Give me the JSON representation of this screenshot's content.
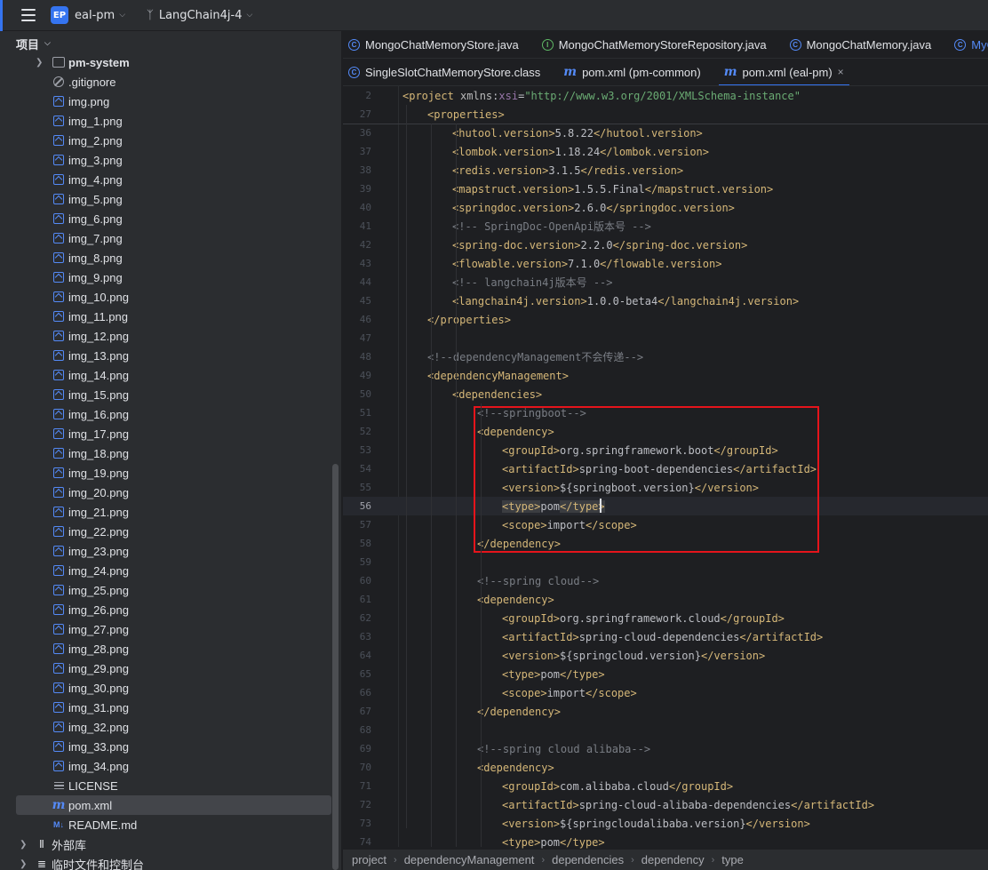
{
  "titlebar": {
    "project_badge": "EP",
    "project_name": "eal-pm",
    "branch_name": "LangChain4j-4"
  },
  "project_panel": {
    "title": "项目",
    "items": [
      {
        "label": "pm-system",
        "icon": "folder-icon",
        "bold": true,
        "expandable": true
      },
      {
        "label": ".gitignore",
        "icon": "ignore-icon"
      },
      {
        "label": "img.png",
        "icon": "image-icon"
      },
      {
        "label": "img_1.png",
        "icon": "image-icon"
      },
      {
        "label": "img_2.png",
        "icon": "image-icon"
      },
      {
        "label": "img_3.png",
        "icon": "image-icon"
      },
      {
        "label": "img_4.png",
        "icon": "image-icon"
      },
      {
        "label": "img_5.png",
        "icon": "image-icon"
      },
      {
        "label": "img_6.png",
        "icon": "image-icon"
      },
      {
        "label": "img_7.png",
        "icon": "image-icon"
      },
      {
        "label": "img_8.png",
        "icon": "image-icon"
      },
      {
        "label": "img_9.png",
        "icon": "image-icon"
      },
      {
        "label": "img_10.png",
        "icon": "image-icon"
      },
      {
        "label": "img_11.png",
        "icon": "image-icon"
      },
      {
        "label": "img_12.png",
        "icon": "image-icon"
      },
      {
        "label": "img_13.png",
        "icon": "image-icon"
      },
      {
        "label": "img_14.png",
        "icon": "image-icon"
      },
      {
        "label": "img_15.png",
        "icon": "image-icon"
      },
      {
        "label": "img_16.png",
        "icon": "image-icon"
      },
      {
        "label": "img_17.png",
        "icon": "image-icon"
      },
      {
        "label": "img_18.png",
        "icon": "image-icon"
      },
      {
        "label": "img_19.png",
        "icon": "image-icon"
      },
      {
        "label": "img_20.png",
        "icon": "image-icon"
      },
      {
        "label": "img_21.png",
        "icon": "image-icon"
      },
      {
        "label": "img_22.png",
        "icon": "image-icon"
      },
      {
        "label": "img_23.png",
        "icon": "image-icon"
      },
      {
        "label": "img_24.png",
        "icon": "image-icon"
      },
      {
        "label": "img_25.png",
        "icon": "image-icon"
      },
      {
        "label": "img_26.png",
        "icon": "image-icon"
      },
      {
        "label": "img_27.png",
        "icon": "image-icon"
      },
      {
        "label": "img_28.png",
        "icon": "image-icon"
      },
      {
        "label": "img_29.png",
        "icon": "image-icon"
      },
      {
        "label": "img_30.png",
        "icon": "image-icon"
      },
      {
        "label": "img_31.png",
        "icon": "image-icon"
      },
      {
        "label": "img_32.png",
        "icon": "image-icon"
      },
      {
        "label": "img_33.png",
        "icon": "image-icon"
      },
      {
        "label": "img_34.png",
        "icon": "image-icon"
      },
      {
        "label": "LICENSE",
        "icon": "text-file-icon"
      },
      {
        "label": "pom.xml",
        "icon": "maven-icon",
        "selected": true
      },
      {
        "label": "README.md",
        "icon": "markdown-icon"
      },
      {
        "label": "外部库",
        "icon": "library-icon",
        "expandable": true,
        "root": true
      },
      {
        "label": "临时文件和控制台",
        "icon": "scratches-icon",
        "expandable": true,
        "root": true
      }
    ]
  },
  "editor": {
    "tabs_row1": [
      {
        "label": "MongoChatMemoryStore.java",
        "icon": "class-icon"
      },
      {
        "label": "MongoChatMemoryStoreRepository.java",
        "icon": "interface-icon"
      },
      {
        "label": "MongoChatMemory.java",
        "icon": "class-icon"
      },
      {
        "label": "MyChatAssi",
        "icon": "class-icon",
        "link": true
      }
    ],
    "tabs_row2": [
      {
        "label": "SingleSlotChatMemoryStore.class",
        "icon": "class-icon"
      },
      {
        "label": "pom.xml (pm-common)",
        "icon": "maven-icon"
      },
      {
        "label": "pom.xml (eal-pm)",
        "icon": "maven-icon",
        "active": true,
        "close": "×"
      }
    ],
    "current_line": 56,
    "lines": [
      {
        "n": 2,
        "indent": 0,
        "parts": [
          [
            "tag",
            "<project "
          ],
          [
            "attr",
            "xmlns"
          ],
          [
            "txt",
            ":"
          ],
          [
            "ns",
            "xsi"
          ],
          [
            "txt",
            "="
          ],
          [
            "str",
            "\"http://www.w3.org/2001/XMLSchema-instance\""
          ],
          [
            "tag",
            ""
          ]
        ]
      },
      {
        "n": 27,
        "indent": 1,
        "parts": [
          [
            "tag",
            "<properties>"
          ]
        ]
      },
      {
        "n": 36,
        "indent": 2,
        "parts": [
          [
            "tag",
            "<hutool.version>"
          ],
          [
            "txt",
            "5.8.22"
          ],
          [
            "tag",
            "</hutool.version>"
          ]
        ]
      },
      {
        "n": 37,
        "indent": 2,
        "parts": [
          [
            "tag",
            "<lombok.version>"
          ],
          [
            "txt",
            "1.18.24"
          ],
          [
            "tag",
            "</lombok.version>"
          ]
        ]
      },
      {
        "n": 38,
        "indent": 2,
        "parts": [
          [
            "tag",
            "<redis.version>"
          ],
          [
            "txt",
            "3.1.5"
          ],
          [
            "tag",
            "</redis.version>"
          ]
        ]
      },
      {
        "n": 39,
        "indent": 2,
        "parts": [
          [
            "tag",
            "<mapstruct.version>"
          ],
          [
            "txt",
            "1.5.5.Final"
          ],
          [
            "tag",
            "</mapstruct.version>"
          ]
        ]
      },
      {
        "n": 40,
        "indent": 2,
        "parts": [
          [
            "tag",
            "<springdoc.version>"
          ],
          [
            "txt",
            "2.6.0"
          ],
          [
            "tag",
            "</springdoc.version>"
          ]
        ]
      },
      {
        "n": 41,
        "indent": 2,
        "parts": [
          [
            "cmt",
            "<!-- SpringDoc-OpenApi版本号 -->"
          ]
        ]
      },
      {
        "n": 42,
        "indent": 2,
        "parts": [
          [
            "tag",
            "<spring-doc.version>"
          ],
          [
            "txt",
            "2.2.0"
          ],
          [
            "tag",
            "</spring-doc.version>"
          ]
        ]
      },
      {
        "n": 43,
        "indent": 2,
        "parts": [
          [
            "tag",
            "<flowable.version>"
          ],
          [
            "txt",
            "7.1.0"
          ],
          [
            "tag",
            "</flowable.version>"
          ]
        ]
      },
      {
        "n": 44,
        "indent": 2,
        "parts": [
          [
            "cmt",
            "<!-- langchain4j版本号 -->"
          ]
        ]
      },
      {
        "n": 45,
        "indent": 2,
        "parts": [
          [
            "tag",
            "<langchain4j.version>"
          ],
          [
            "txt",
            "1.0.0-beta4"
          ],
          [
            "tag",
            "</langchain4j.version>"
          ]
        ]
      },
      {
        "n": 46,
        "indent": 1,
        "parts": [
          [
            "tag",
            "</properties>"
          ]
        ]
      },
      {
        "n": 47,
        "indent": 0,
        "parts": []
      },
      {
        "n": 48,
        "indent": 1,
        "parts": [
          [
            "cmt",
            "<!--dependencyManagement不会传递-->"
          ]
        ]
      },
      {
        "n": 49,
        "indent": 1,
        "parts": [
          [
            "tag",
            "<dependencyManagement>"
          ]
        ]
      },
      {
        "n": 50,
        "indent": 2,
        "parts": [
          [
            "tag",
            "<dependencies>"
          ]
        ]
      },
      {
        "n": 51,
        "indent": 3,
        "parts": [
          [
            "cmt",
            "<!--springboot-->"
          ]
        ]
      },
      {
        "n": 52,
        "indent": 3,
        "parts": [
          [
            "tag",
            "<dependency>"
          ]
        ]
      },
      {
        "n": 53,
        "indent": 4,
        "parts": [
          [
            "tag",
            "<groupId>"
          ],
          [
            "txt",
            "org.springframework.boot"
          ],
          [
            "tag",
            "</groupId>"
          ]
        ]
      },
      {
        "n": 54,
        "indent": 4,
        "parts": [
          [
            "tag",
            "<artifactId>"
          ],
          [
            "txt",
            "spring-boot-dependencies"
          ],
          [
            "tag",
            "</artifactId>"
          ]
        ]
      },
      {
        "n": 55,
        "indent": 4,
        "parts": [
          [
            "tag",
            "<version>"
          ],
          [
            "txt",
            "${springboot.version}"
          ],
          [
            "tag",
            "</version>"
          ]
        ]
      },
      {
        "n": 56,
        "indent": 4,
        "parts": [
          [
            "tag hl",
            "<type>"
          ],
          [
            "txt",
            "pom"
          ],
          [
            "tag hl",
            "</type>"
          ]
        ]
      },
      {
        "n": 57,
        "indent": 4,
        "parts": [
          [
            "tag",
            "<scope>"
          ],
          [
            "txt",
            "import"
          ],
          [
            "tag",
            "</scope>"
          ]
        ]
      },
      {
        "n": 58,
        "indent": 3,
        "parts": [
          [
            "tag",
            "</dependency>"
          ]
        ]
      },
      {
        "n": 59,
        "indent": 0,
        "parts": []
      },
      {
        "n": 60,
        "indent": 3,
        "parts": [
          [
            "cmt",
            "<!--spring cloud-->"
          ]
        ]
      },
      {
        "n": 61,
        "indent": 3,
        "parts": [
          [
            "tag",
            "<dependency>"
          ]
        ]
      },
      {
        "n": 62,
        "indent": 4,
        "parts": [
          [
            "tag",
            "<groupId>"
          ],
          [
            "txt",
            "org.springframework.cloud"
          ],
          [
            "tag",
            "</groupId>"
          ]
        ]
      },
      {
        "n": 63,
        "indent": 4,
        "parts": [
          [
            "tag",
            "<artifactId>"
          ],
          [
            "txt",
            "spring-cloud-dependencies"
          ],
          [
            "tag",
            "</artifactId>"
          ]
        ]
      },
      {
        "n": 64,
        "indent": 4,
        "parts": [
          [
            "tag",
            "<version>"
          ],
          [
            "txt",
            "${springcloud.version}"
          ],
          [
            "tag",
            "</version>"
          ]
        ]
      },
      {
        "n": 65,
        "indent": 4,
        "parts": [
          [
            "tag",
            "<type>"
          ],
          [
            "txt",
            "pom"
          ],
          [
            "tag",
            "</type>"
          ]
        ]
      },
      {
        "n": 66,
        "indent": 4,
        "parts": [
          [
            "tag",
            "<scope>"
          ],
          [
            "txt",
            "import"
          ],
          [
            "tag",
            "</scope>"
          ]
        ]
      },
      {
        "n": 67,
        "indent": 3,
        "parts": [
          [
            "tag",
            "</dependency>"
          ]
        ]
      },
      {
        "n": 68,
        "indent": 0,
        "parts": []
      },
      {
        "n": 69,
        "indent": 3,
        "parts": [
          [
            "cmt",
            "<!--spring cloud alibaba-->"
          ]
        ]
      },
      {
        "n": 70,
        "indent": 3,
        "parts": [
          [
            "tag",
            "<dependency>"
          ]
        ]
      },
      {
        "n": 71,
        "indent": 4,
        "parts": [
          [
            "tag",
            "<groupId>"
          ],
          [
            "txt",
            "com.alibaba.cloud"
          ],
          [
            "tag",
            "</groupId>"
          ]
        ]
      },
      {
        "n": 72,
        "indent": 4,
        "parts": [
          [
            "tag",
            "<artifactId>"
          ],
          [
            "txt",
            "spring-cloud-alibaba-dependencies"
          ],
          [
            "tag",
            "</artifactId>"
          ]
        ]
      },
      {
        "n": 73,
        "indent": 4,
        "parts": [
          [
            "tag",
            "<version>"
          ],
          [
            "txt",
            "${springcloudalibaba.version}"
          ],
          [
            "tag",
            "</version>"
          ]
        ]
      },
      {
        "n": 74,
        "indent": 4,
        "parts": [
          [
            "tag",
            "<type>"
          ],
          [
            "txt",
            "pom"
          ],
          [
            "tag",
            "</type>"
          ]
        ]
      }
    ]
  },
  "breadcrumbs": [
    "project",
    "dependencyManagement",
    "dependencies",
    "dependency",
    "type"
  ],
  "colors": {
    "accent": "#3574f0",
    "annotation_box": "#e5141b",
    "tag": "#d5b778",
    "comment": "#7a7e85",
    "string": "#6aab73"
  }
}
